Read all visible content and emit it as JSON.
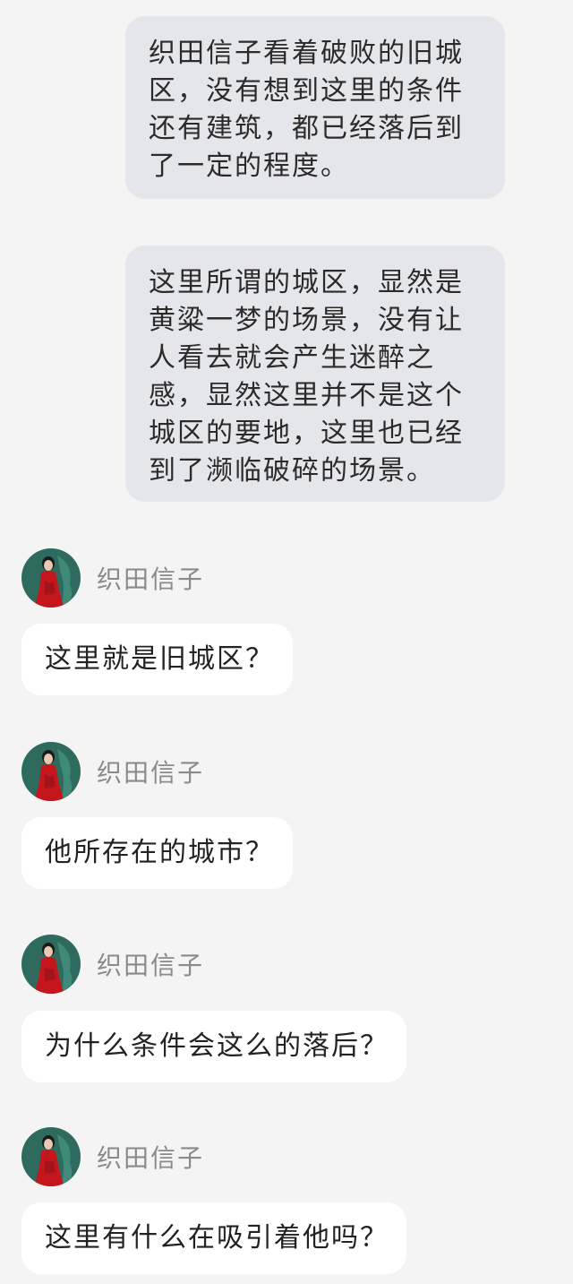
{
  "narrations": [
    "织田信子看着破败的旧城区，没有想到这里的条件还有建筑，都已经落后到了一定的程度。",
    "这里所谓的城区，显然是黄粱一梦的场景，没有让人看去就会产生迷醉之感，显然这里并不是这个城区的要地，这里也已经到了濒临破碎的场景。"
  ],
  "messages": [
    {
      "sender": "织田信子",
      "text": "这里就是旧城区？"
    },
    {
      "sender": "织田信子",
      "text": "他所存在的城市？"
    },
    {
      "sender": "织田信子",
      "text": "为什么条件会这么的落后？"
    },
    {
      "sender": "织田信子",
      "text": "这里有什么在吸引着他吗？"
    }
  ],
  "colors": {
    "background": "#f4f4f4",
    "narration_bubble": "#e5e6ec",
    "message_bubble": "#ffffff",
    "sender_name": "#8a8a8a",
    "avatar_dress": "#c4161c",
    "avatar_backdrop": "#2e6b5e"
  }
}
